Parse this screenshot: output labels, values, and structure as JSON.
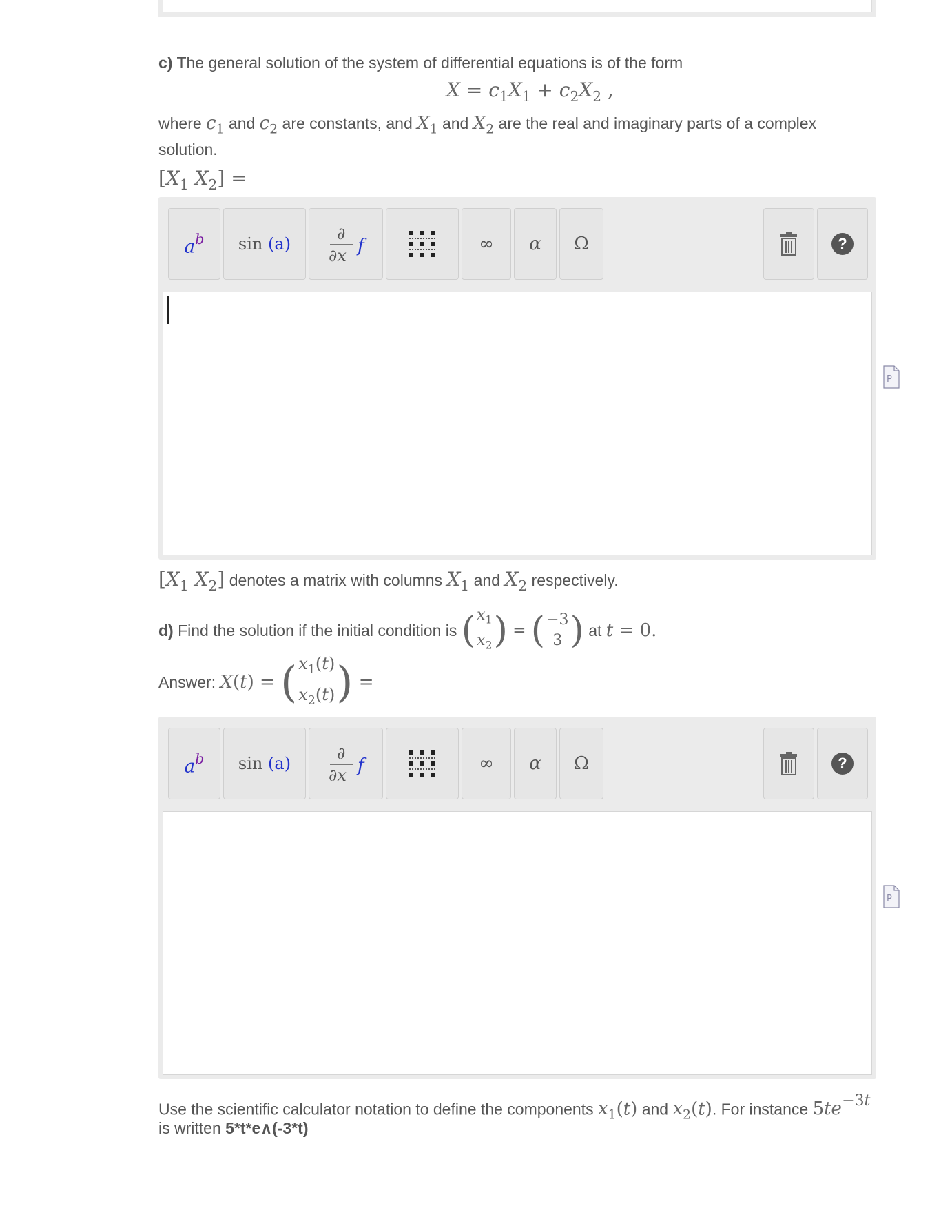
{
  "part_c": {
    "label": "c)",
    "intro": "The general solution of the system of differential equations is of the form",
    "where_word": "where",
    "and_word": "and",
    "are_constants": "are constants, and",
    "real_imag": "are the real and imaginary parts of a complex",
    "solution_word": "solution.",
    "matrix_note": "denotes a matrix with columns",
    "respectively": "respectively."
  },
  "part_d": {
    "label": "d)",
    "intro": "Find the solution if the initial condition is",
    "at_word": "at",
    "ic_values": [
      "−3",
      "3"
    ],
    "answer_label": "Answer:"
  },
  "footer": {
    "text1": "Use the scientific calculator notation to define the components",
    "text2": "and",
    "text3": ". For instance",
    "text4": "is written",
    "example": "5*t*e∧(-3*t)"
  },
  "toolbar": {
    "power_icon": "power-icon",
    "sin_label": "sin",
    "sin_arg": "(a)",
    "infinity": "∞",
    "alpha": "α",
    "omega": "Ω",
    "trash_icon": "trash-icon",
    "help_icon": "help-icon",
    "help_glyph": "?"
  }
}
